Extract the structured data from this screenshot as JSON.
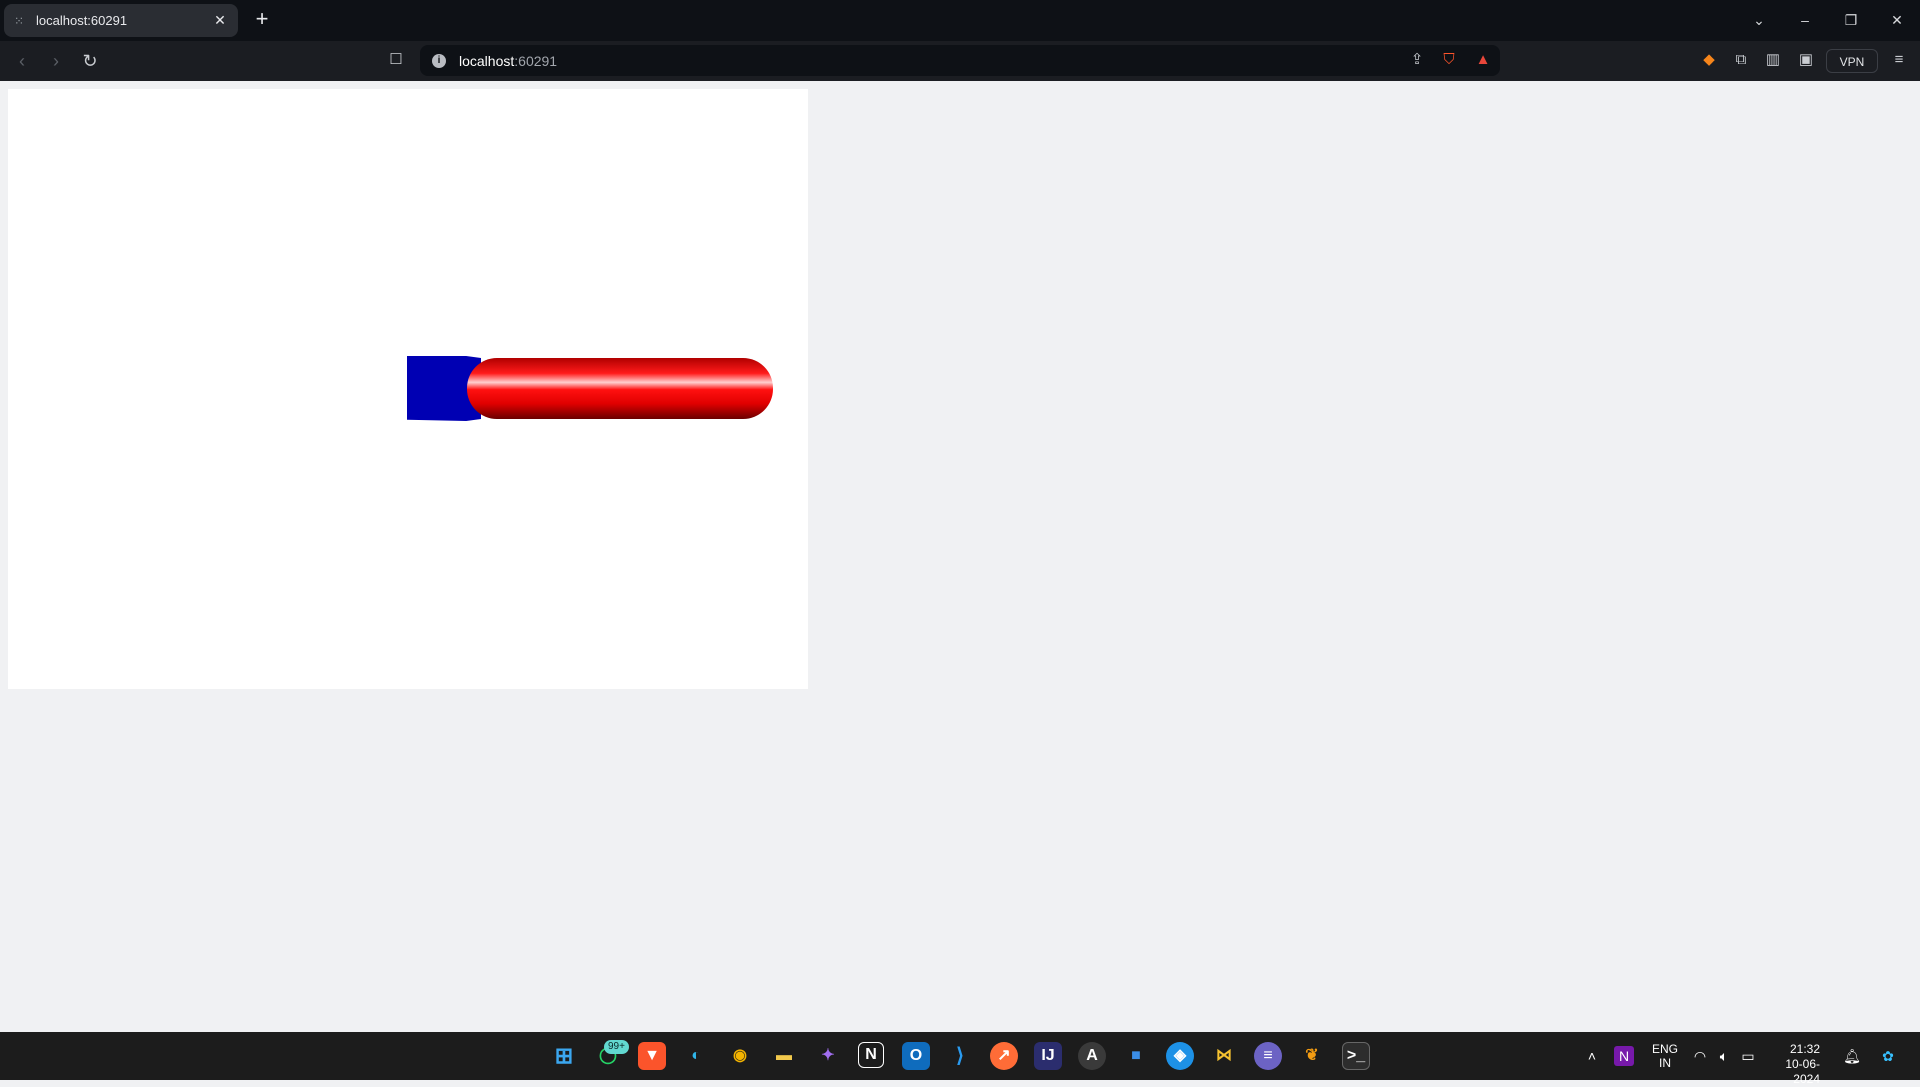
{
  "browser": {
    "tab_title": "localhost:60291",
    "url_host": "localhost",
    "url_port": ":60291",
    "vpn_label": "VPN"
  },
  "scene": {
    "background": "#ffffff",
    "objects": [
      {
        "name": "blue-box",
        "color": "#0000b3"
      },
      {
        "name": "red-cylinder",
        "color": "#ff0000"
      }
    ]
  },
  "taskbar": {
    "badge": "99+",
    "lang_line1": "ENG",
    "lang_line2": "IN",
    "time": "21:32",
    "date": "10-06-2024",
    "icons": [
      "windows-start-icon",
      "whatsapp-icon",
      "brave-icon",
      "edge-icon",
      "chrome-icon",
      "file-explorer-icon",
      "app-icon",
      "notion-icon",
      "outlook-icon",
      "vscode-icon",
      "postman-icon",
      "intellij-icon",
      "app-store-icon",
      "app-icon",
      "docker-icon",
      "app-icon",
      "app-icon",
      "fl-studio-icon",
      "terminal-icon"
    ]
  }
}
